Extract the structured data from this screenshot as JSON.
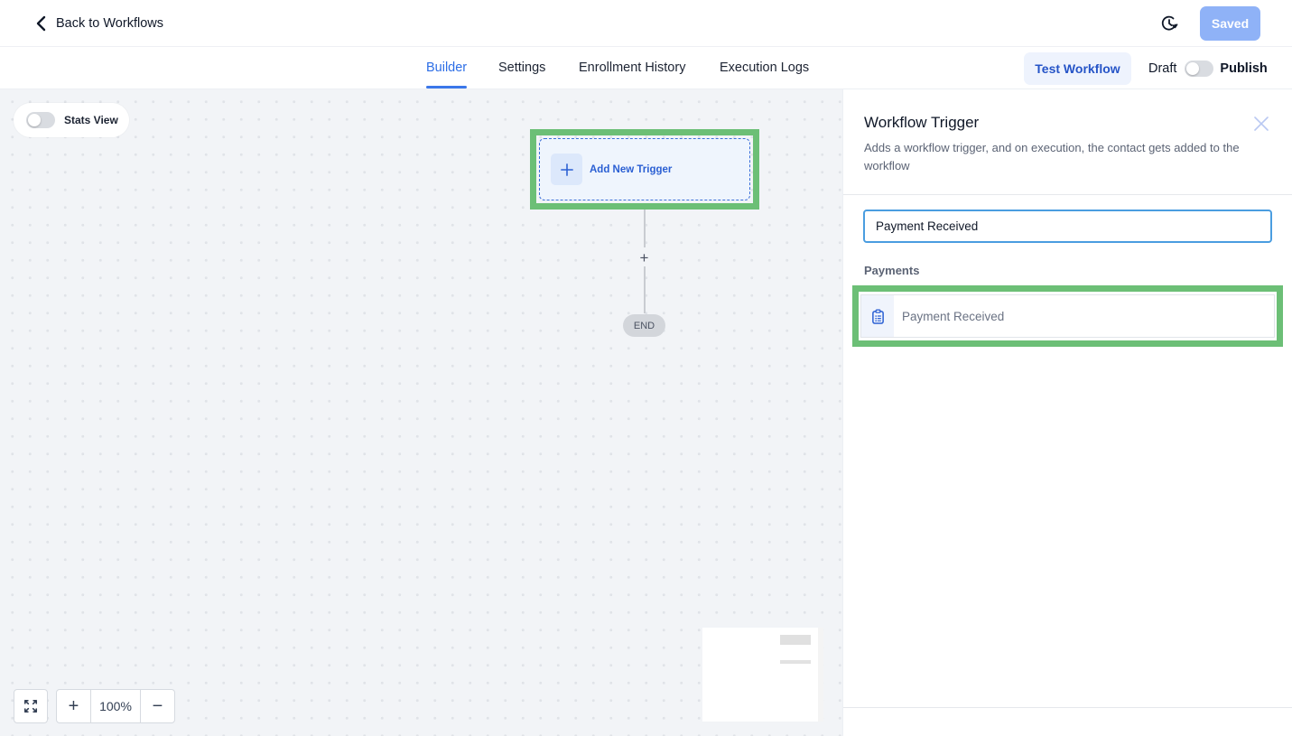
{
  "header": {
    "back_label": "Back to Workflows",
    "saved_label": "Saved",
    "history_icon": "history-clock-icon"
  },
  "tabs": [
    {
      "label": "Builder",
      "active": true
    },
    {
      "label": "Settings",
      "active": false
    },
    {
      "label": "Enrollment History",
      "active": false
    },
    {
      "label": "Execution Logs",
      "active": false
    }
  ],
  "actions": {
    "test_label": "Test Workflow",
    "draft_label": "Draft",
    "publish_label": "Publish",
    "publish_enabled": false
  },
  "canvas": {
    "stats_view_label": "Stats View",
    "stats_view_enabled": false,
    "trigger_node_label": "Add New Trigger",
    "add_step_symbol": "+",
    "end_label": "END",
    "zoom_in_symbol": "+",
    "zoom_level": "100%",
    "zoom_out_symbol": "−"
  },
  "panel": {
    "title": "Workflow Trigger",
    "description": "Adds a workflow trigger, and on execution, the contact gets added to the workflow",
    "search_value": "Payment Received",
    "groups": [
      {
        "label": "Payments",
        "items": [
          {
            "label": "Payment Received",
            "icon": "clipboard-list-icon"
          }
        ]
      }
    ]
  },
  "colors": {
    "accent": "#3b77ea",
    "saved_button": "#8fb2f7",
    "highlight": "#6cbf76",
    "canvas_bg": "#f2f4f7"
  }
}
